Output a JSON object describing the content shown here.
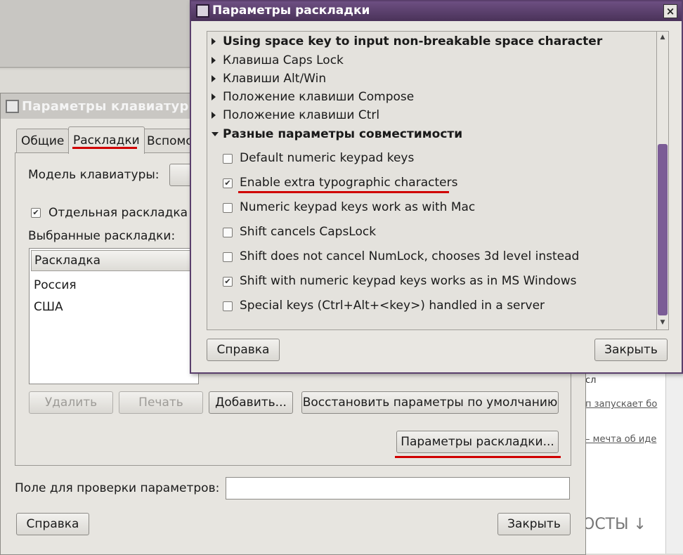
{
  "keyboard_window": {
    "title": "Параметры клавиатуры",
    "tabs": [
      {
        "label": "Общие"
      },
      {
        "label": "Раскладки"
      },
      {
        "label": "Вспомо"
      }
    ],
    "model_label": "Модель клавиатуры:",
    "separate_layout_label": "Отдельная раскладка д",
    "separate_layout_checked": true,
    "selected_layouts_label": "Выбранные раскладки:",
    "list_header": "Раскладка",
    "layouts": [
      "Россия",
      "США"
    ],
    "buttons": {
      "remove": "Удалить",
      "print": "Печать",
      "add": "Добавить...",
      "reset": "Восстановить параметры по умолчанию",
      "layout_options": "Параметры раскладки..."
    },
    "test_field_label": "Поле для проверки параметров:",
    "help": "Справка",
    "close": "Закрыть"
  },
  "layout_options_dialog": {
    "title": "Параметры раскладки",
    "close_glyph": "×",
    "groups": [
      {
        "label": "Using space key to input non-breakable space character",
        "expanded": false,
        "bold": true
      },
      {
        "label": "Клавиша Caps Lock",
        "expanded": false,
        "bold": false
      },
      {
        "label": "Клавиши Alt/Win",
        "expanded": false,
        "bold": false
      },
      {
        "label": "Положение клавиши Compose",
        "expanded": false,
        "bold": false
      },
      {
        "label": "Положение клавиши Ctrl",
        "expanded": false,
        "bold": false
      },
      {
        "label": "Разные параметры совместимости",
        "expanded": true,
        "bold": true
      }
    ],
    "options": [
      {
        "label": "Default numeric keypad keys",
        "checked": false
      },
      {
        "label": "Enable extra typographic characters",
        "checked": true
      },
      {
        "label": "Numeric keypad keys work as with Mac",
        "checked": false
      },
      {
        "label": "Shift cancels CapsLock",
        "checked": false
      },
      {
        "label": "Shift does not cancel NumLock, chooses 3d level instead",
        "checked": false
      },
      {
        "label": "Shift with numeric keypad keys works as in MS Windows",
        "checked": true
      },
      {
        "label": "Special keys (Ctrl+Alt+<key>) handled in a server",
        "checked": false
      }
    ],
    "help": "Справка",
    "close": "Закрыть"
  },
  "background_page": {
    "lines": [
      "п запускает бо",
      "– мечта об иде",
      "ОСТЫ ↓"
    ],
    "corner_text": "сл"
  },
  "colors": {
    "highlight_underline": "#d00000",
    "dialog_title": "#5a3f6c",
    "scroll_thumb": "#7b5c96"
  }
}
